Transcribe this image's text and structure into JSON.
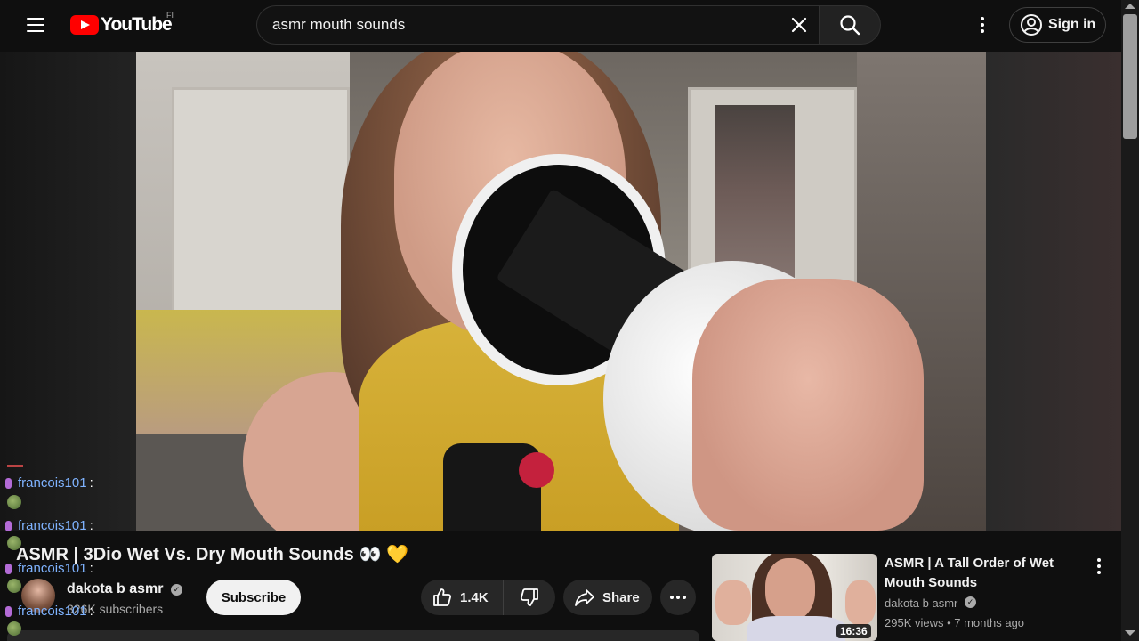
{
  "header": {
    "logo_text": "YouTube",
    "country_code": "FI",
    "search": {
      "value": "asmr mouth sounds",
      "placeholder": "Search"
    },
    "signin_label": "Sign in"
  },
  "video": {
    "title": "ASMR | 3Dio Wet Vs. Dry Mouth Sounds",
    "title_emojis": "👀 💛",
    "channel_name": "dakota b asmr",
    "subscribers": "326K subscribers",
    "subscribe_label": "Subscribe",
    "like_count": "1.4K",
    "share_label": "Share"
  },
  "chat": {
    "messages": [
      {
        "user": "francois101",
        "sep": ":"
      },
      {
        "user": "francois101",
        "sep": ":"
      },
      {
        "user": "francois101",
        "sep": ":"
      },
      {
        "user": "francois101",
        "sep": ":"
      }
    ]
  },
  "recommendation": {
    "title": "ASMR | A Tall Order of Wet Mouth Sounds",
    "channel": "dakota b asmr",
    "meta": "295K views • 7 months ago",
    "duration": "16:36"
  },
  "colors": {
    "accent": "#ff0000",
    "background": "#0f0f0f",
    "chat_name": "#7fb3ff"
  },
  "icons": [
    "menu-icon",
    "youtube-logo-icon",
    "clear-icon",
    "search-icon",
    "more-vert-icon",
    "account-icon",
    "verified-icon",
    "thumb-up-icon",
    "thumb-down-icon",
    "share-icon",
    "more-horiz-icon",
    "mic-icon",
    "emote-icon"
  ]
}
